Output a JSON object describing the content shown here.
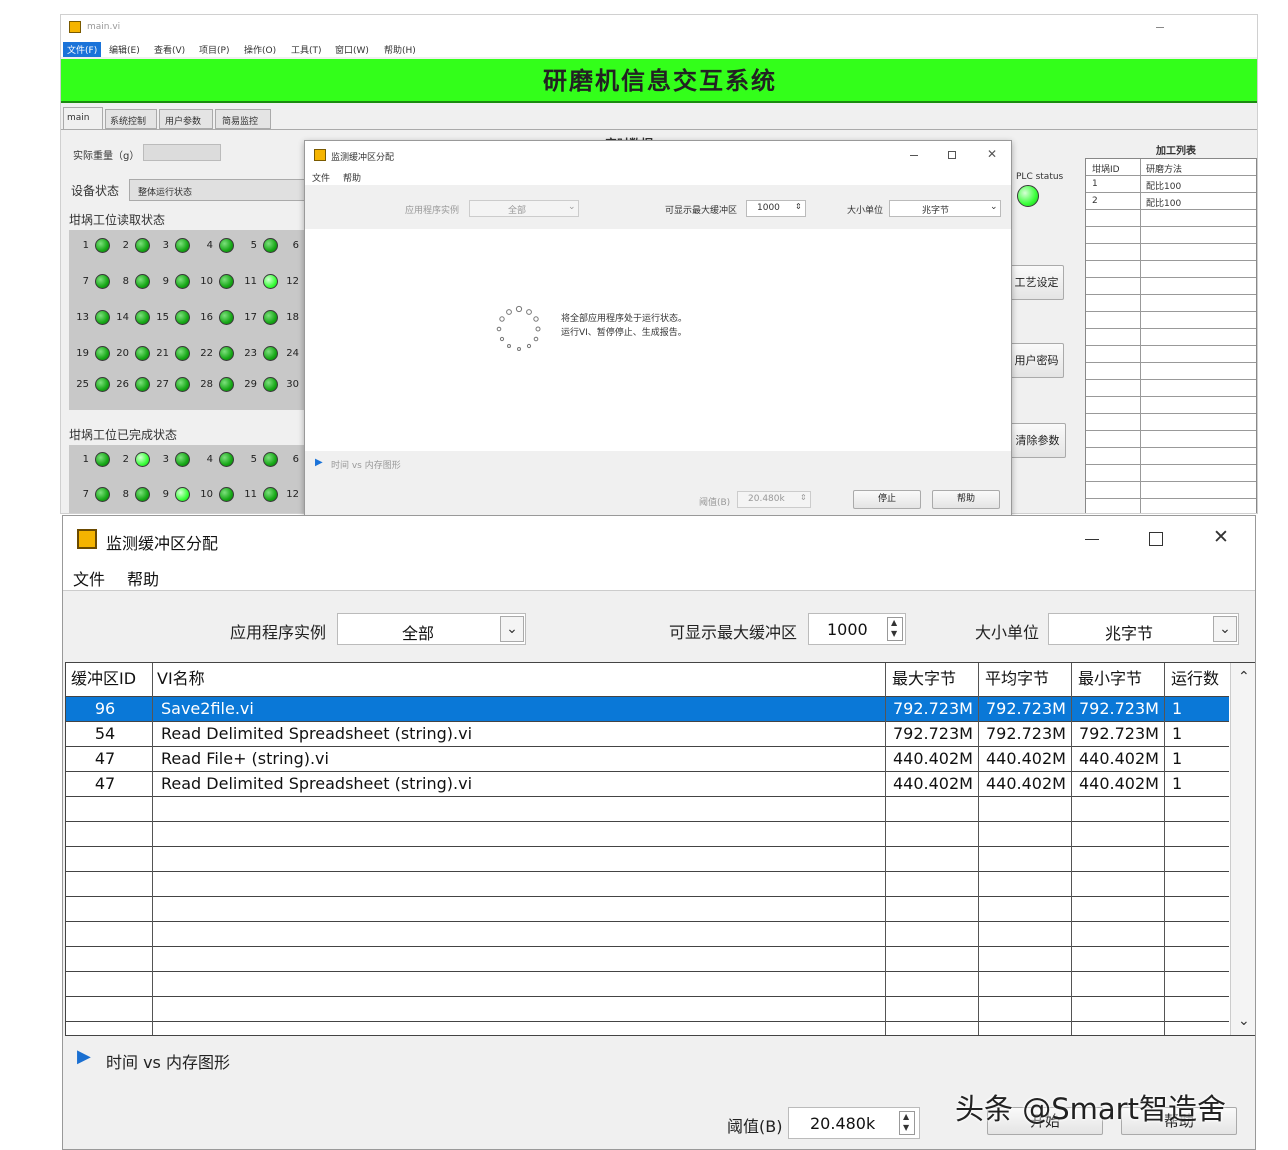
{
  "main_window": {
    "title": "main.vi",
    "menu": [
      "文件(F)",
      "编辑(E)",
      "查看(V)",
      "项目(P)",
      "操作(O)",
      "工具(T)",
      "窗口(W)",
      "帮助(H)"
    ],
    "banner": "研磨机信息交互系统",
    "tabs": [
      "main",
      "系统控制",
      "用户参数",
      "简易监控"
    ],
    "actual_weight_label": "实际重量（g）",
    "device_status_label": "设备状态",
    "device_status_value": "整体运行状态",
    "sec1_label": "坩埚工位读取状态",
    "sec2_label": "坩埚工位已完成状态",
    "grid1": [
      [
        "1",
        "2",
        "3",
        "4",
        "5",
        "6"
      ],
      [
        "7",
        "8",
        "9",
        "10",
        "11",
        "12"
      ],
      [
        "13",
        "14",
        "15",
        "16",
        "17",
        "18"
      ],
      [
        "19",
        "20",
        "21",
        "22",
        "23",
        "24"
      ],
      [
        "25",
        "26",
        "27",
        "28",
        "29",
        "30"
      ]
    ],
    "grid2": [
      [
        "1",
        "2",
        "3",
        "4",
        "5",
        "6"
      ],
      [
        "7",
        "8",
        "9",
        "10",
        "11",
        "12"
      ]
    ],
    "center_title": "实时数据",
    "plc_label": "PLC status",
    "side_buttons": [
      "工艺设定",
      "用户密码",
      "清除参数"
    ],
    "list_title": "加工列表",
    "list_headers": [
      "坩埚ID",
      "研磨方法"
    ],
    "list_rows": [
      [
        "1",
        "配比100"
      ],
      [
        "2",
        "配比100"
      ]
    ]
  },
  "small_dialog": {
    "title": "监测缓冲区分配",
    "menu": [
      "文件",
      "帮助"
    ],
    "app_instance_label": "应用程序实例",
    "app_instance_value": "全部",
    "max_buffers_label": "可显示最大缓冲区",
    "max_buffers_value": "1000",
    "unit_label": "大小单位",
    "unit_value": "兆字节",
    "loading_line1": "将全部应用程序处于运行状态。",
    "loading_line2": "运行VI、暂停停止、生成报告。",
    "graph_toggle": "时间 vs 内存图形",
    "threshold_label": "阈值(B)",
    "threshold_value": "20.480k",
    "btn1": "停止",
    "btn2": "帮助"
  },
  "big_dialog": {
    "title": "监测缓冲区分配",
    "menu": [
      "文件",
      "帮助"
    ],
    "app_instance_label": "应用程序实例",
    "app_instance_value": "全部",
    "max_buffers_label": "可显示最大缓冲区",
    "max_buffers_value": "1000",
    "unit_label": "大小单位",
    "unit_value": "兆字节",
    "table": {
      "headers": [
        "缓冲区ID",
        "VI名称",
        "最大字节",
        "平均字节",
        "最小字节",
        "运行数"
      ],
      "rows": [
        [
          "96",
          "Save2file.vi",
          "792.723M",
          "792.723M",
          "792.723M",
          "1"
        ],
        [
          "54",
          "Read Delimited Spreadsheet (string).vi",
          "792.723M",
          "792.723M",
          "792.723M",
          "1"
        ],
        [
          "47",
          "Read File+ (string).vi",
          "440.402M",
          "440.402M",
          "440.402M",
          "1"
        ],
        [
          "47",
          "Read Delimited Spreadsheet (string).vi",
          "440.402M",
          "440.402M",
          "440.402M",
          "1"
        ]
      ]
    },
    "graph_toggle": "时间 vs 内存图形",
    "threshold_label": "阈值(B)",
    "threshold_value": "20.480k",
    "btn1": "开始",
    "btn2": "帮助"
  },
  "watermark": "头条 @Smart智造舍",
  "colors": {
    "banner": "#33ff1a",
    "selection": "#0a78d7",
    "led": "#1aa81a"
  }
}
